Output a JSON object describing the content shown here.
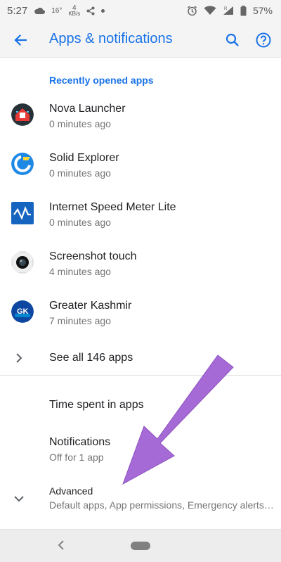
{
  "status_bar": {
    "time": "5:27",
    "temp": "16°",
    "speed_value": "4",
    "speed_unit": "KB/s",
    "battery": "57%"
  },
  "toolbar": {
    "title": "Apps & notifications"
  },
  "recent": {
    "header": "Recently opened apps",
    "apps": [
      {
        "name": "Nova Launcher",
        "time": "0 minutes ago",
        "icon": "nova-launcher-icon"
      },
      {
        "name": "Solid Explorer",
        "time": "0 minutes ago",
        "icon": "solid-explorer-icon"
      },
      {
        "name": "Internet Speed Meter Lite",
        "time": "0 minutes ago",
        "icon": "speed-meter-icon"
      },
      {
        "name": "Screenshot touch",
        "time": "4 minutes ago",
        "icon": "screenshot-touch-icon"
      },
      {
        "name": "Greater Kashmir",
        "time": "7 minutes ago",
        "icon": "greater-kashmir-icon"
      }
    ]
  },
  "see_all": {
    "label": "See all 146 apps"
  },
  "time_spent": {
    "label": "Time spent in apps"
  },
  "notifications": {
    "title": "Notifications",
    "subtitle": "Off for 1 app"
  },
  "advanced": {
    "title": "Advanced",
    "subtitle": "Default apps, App permissions, Emergency alerts, Special app access"
  },
  "icons": {
    "gk_text": "GK"
  },
  "colors": {
    "accent": "#1a73e8",
    "arrow": "#a66ad6",
    "primary_text": "#202124",
    "secondary_text": "#757575"
  }
}
